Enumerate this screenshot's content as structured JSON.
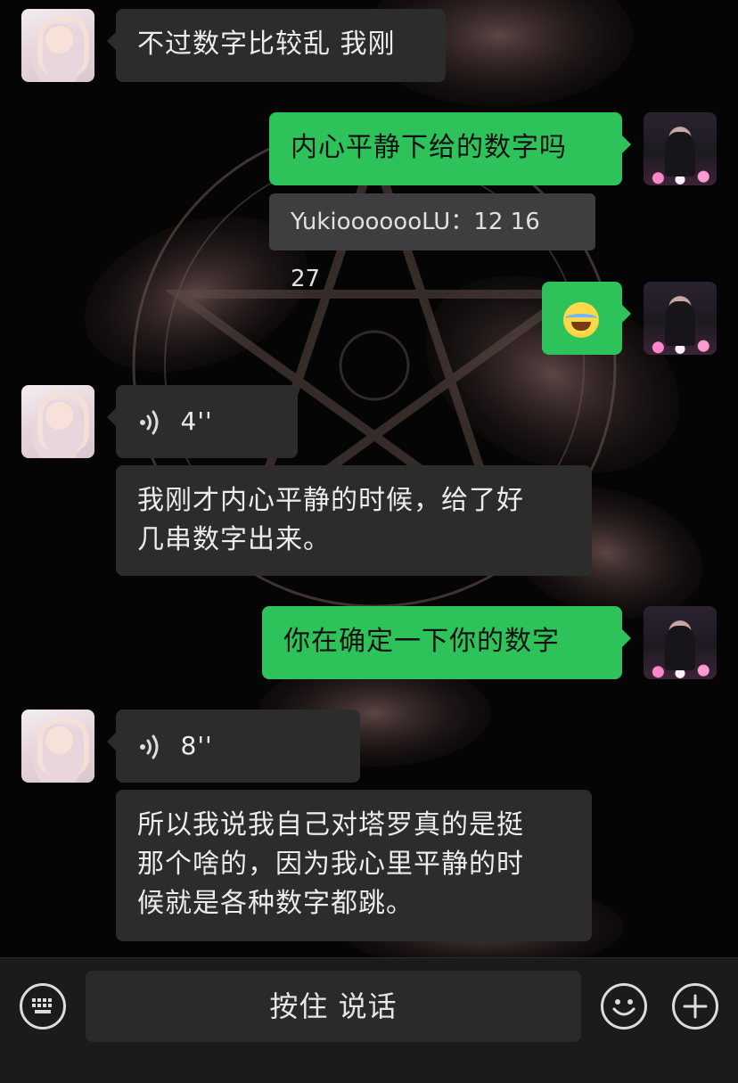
{
  "messages": [
    {
      "id": "m1",
      "from": "peer",
      "type": "text",
      "text": "不过数字比较乱 我刚"
    },
    {
      "id": "m2",
      "from": "me",
      "type": "text",
      "text": "内心平静下给的数字吗"
    },
    {
      "id": "m3",
      "from": "me",
      "type": "quote",
      "text": "YukiooooooLU：12 16 27"
    },
    {
      "id": "m4",
      "from": "me",
      "type": "emoji",
      "emoji": "face-with-tears-of-joy"
    },
    {
      "id": "m5",
      "from": "peer",
      "type": "voice",
      "duration": "4''"
    },
    {
      "id": "m6",
      "from": "peer",
      "type": "text",
      "lines": [
        "我刚才内心平静的时候，给了好",
        "几串数字出来。"
      ]
    },
    {
      "id": "m7",
      "from": "me",
      "type": "text",
      "text": "你在确定一下你的数字"
    },
    {
      "id": "m8",
      "from": "peer",
      "type": "voice",
      "duration": "8''"
    },
    {
      "id": "m9",
      "from": "peer",
      "type": "text",
      "lines": [
        "所以我说我自己对塔罗真的是挺",
        "那个啥的，因为我心里平静的时",
        "候就是各种数字都跳。"
      ]
    }
  ],
  "input_bar": {
    "hold_to_talk_label": "按住 说话",
    "keyboard_icon": "keyboard-icon",
    "emoji_icon": "smiley-icon",
    "plus_icon": "plus-icon"
  },
  "colors": {
    "my_bubble": "#2dc25a",
    "peer_bubble": "#2c2c2c",
    "background": "#050505"
  }
}
